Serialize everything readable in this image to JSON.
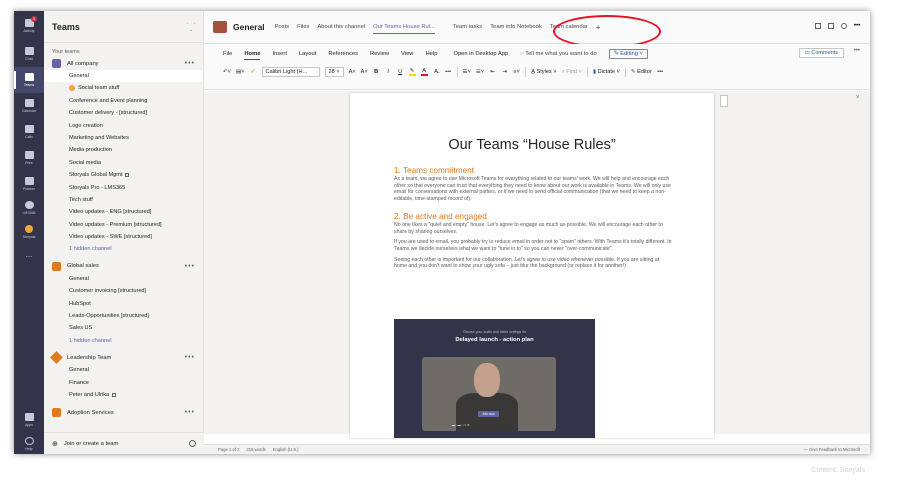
{
  "rail": {
    "items": [
      {
        "label": "Activity",
        "icon": "bell-icon",
        "badge": "1"
      },
      {
        "label": "Chat",
        "icon": "chat-icon"
      },
      {
        "label": "Teams",
        "icon": "teams-icon"
      },
      {
        "label": "Calendar",
        "icon": "calendar-icon"
      },
      {
        "label": "Calls",
        "icon": "phone-icon"
      },
      {
        "label": "Files",
        "icon": "file-icon"
      },
      {
        "label": "Planner",
        "icon": "planner-icon"
      },
      {
        "label": "LMS365",
        "icon": "lms-icon"
      },
      {
        "label": "Storyals",
        "icon": "storyals-icon"
      },
      {
        "label": "...",
        "icon": "more-icon"
      }
    ],
    "bottom": [
      {
        "label": "Apps",
        "icon": "apps-icon"
      },
      {
        "label": "Help",
        "icon": "help-icon"
      }
    ]
  },
  "teams_panel": {
    "title": "Teams",
    "your_teams": "Your teams",
    "teams": [
      {
        "name": "All company",
        "color": "#6264a7",
        "channels": [
          "General",
          "Social team stuff",
          "Conference and Event planning",
          "Customer delivery - [structured]",
          "Logo creation",
          "Marketing and Websites",
          "Media production",
          "Social media",
          "Storyals Global Mgmt",
          "Storyals Pro - LMS365",
          "Tech stuff",
          "Video updates - ENG [structured]",
          "Video updates - Premium [structured]",
          "Video updates - SWE [structured]"
        ],
        "hidden": "1 hidden channel"
      },
      {
        "name": "Global sales",
        "color": "#e07a1f",
        "channels": [
          "General",
          "Customer invoicing [structured]",
          "HubSpot",
          "Leads-Opportunities [structured]",
          "Sales US"
        ],
        "hidden": "1 hidden channel"
      },
      {
        "name": "Leadership Team",
        "color": "#e07a1f",
        "channels": [
          "General",
          "Finance",
          "Peter and Ulrika"
        ],
        "hidden": ""
      }
    ],
    "next_team": "Adoption Services",
    "footer": "Join or create a team"
  },
  "topbar": {
    "title": "General",
    "tabs": [
      "Posts",
      "Files",
      "About this channel",
      "Our Teams House Rul...",
      "Team tasks",
      "Team info Notebook",
      "Team calendar",
      "+"
    ]
  },
  "ribbon": {
    "menu": [
      "File",
      "Home",
      "Insert",
      "Layout",
      "References",
      "Review",
      "View",
      "Help",
      "Open in Desktop App"
    ],
    "tell": "Tell me what you want to do",
    "editing": "Editing",
    "comments": "Comments",
    "font": "Calibri Light (H...",
    "size": "28",
    "styles": "Styles",
    "find": "Find",
    "dictate": "Dictate",
    "editor": "Editor"
  },
  "doc": {
    "title": "Our Teams “House Rules”",
    "h1": "1. Teams commitment",
    "p1": "As a team, we agree to use Microsoft Teams for everything related to our teams' work. We will help and encourage each other so that everyone can trust that everything they need to know about our work is available in Teams. We will only use email for conversations with external parties, or if we need to send official communication (that we need to keep a non-editable, time-stamped record of).",
    "h2": "2. Be active and engaged",
    "p2": "No one likes a \"quiet and empty\" house. Let's agree to engage as much as possible. We will encourage each other to share by sharing ourselves.",
    "p3": "If you are used to email, you probably try to reduce email in order not to \"spam\" others. With Teams it's totally different. In Teams we decide ourselves what we want to \"tune in to\" so you can never \"over-communicate\".",
    "p4a": "Seeing each other is important for our collaboration.",
    "p4b": "Let's agree to use video whenever possible.",
    "p4c": "If you are sitting at home and you don't want to show your ugly sofa – just blur the background (or replace it for another!)",
    "video_top": "Choose your audio and video settings for",
    "video_title": "Delayed launch - action plan",
    "video_join": "Join now"
  },
  "status": {
    "page": "Page 1 of 2",
    "words": "315 words",
    "lang": "English (U.S.)",
    "feedback": "Give Feedback to Microsoft"
  },
  "watermark": "Content: Storyals"
}
